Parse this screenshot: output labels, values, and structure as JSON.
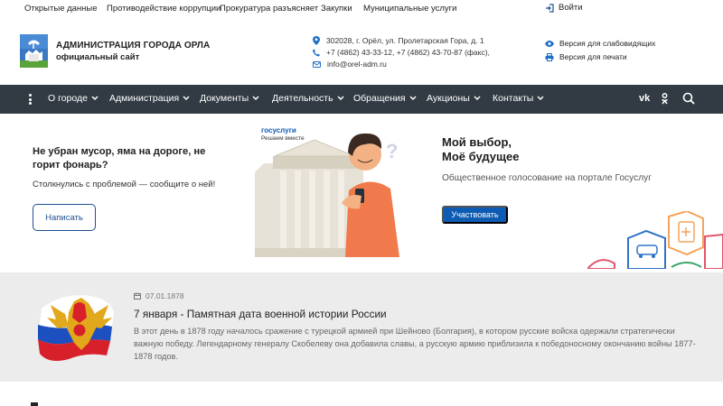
{
  "topbar": {
    "links": [
      "Открытые данные",
      "Противодействие коррупции",
      "Прокуратура разъясняет",
      "Закупки",
      "Муниципальные услуги"
    ],
    "login": "Войти"
  },
  "header": {
    "title": "АДМИНИСТРАЦИЯ ГОРОДА ОРЛА",
    "subtitle": "официальный сайт",
    "address": "302028, г. Орёл, ул. Пролетарская Гора, д. 1",
    "phones": "+7 (4862) 43-33-12,   +7 (4862) 43-70-87 (факс),",
    "email": "info@orel-adm.ru",
    "accessibility": "Версия для слабовидящих",
    "print": "Версия для печати"
  },
  "nav": {
    "items": [
      "О городе",
      "Администрация",
      "Документы",
      "Деятельность",
      "Обращения",
      "Аукционы",
      "Контакты"
    ],
    "vk": "vk",
    "ok": "ok"
  },
  "promo": {
    "brand": "госуслуги",
    "brand_sub": "Решаем вместе",
    "title": "Не убран мусор, яма на дороге, не горит фонарь?",
    "text": "Столкнулись с проблемой — сообщите о ней!",
    "button": "Написать"
  },
  "vote": {
    "title_line1": "Мой выбор,",
    "title_line2": "Моё будущее",
    "text": "Общественное голосование на портале Госуслуг",
    "button": "Участвовать"
  },
  "news": {
    "date": "07.01.1878",
    "title": "7 января - Памятная дата военной истории России",
    "text": "В этот день в 1878 году началось сражение с турецкой армией при Шейново (Болгария), в котором русские войска одержали стратегически важную победу. Легендарному генералу Скобелеву она добавила славы, а русскую армию приблизила к победоносному окончанию войны 1877-1878 годов."
  },
  "colors": {
    "nav_bg": "#323b44",
    "accent_blue": "#0d5bb3",
    "outline_blue": "#1f4f8f",
    "news_bg": "#ececec"
  }
}
